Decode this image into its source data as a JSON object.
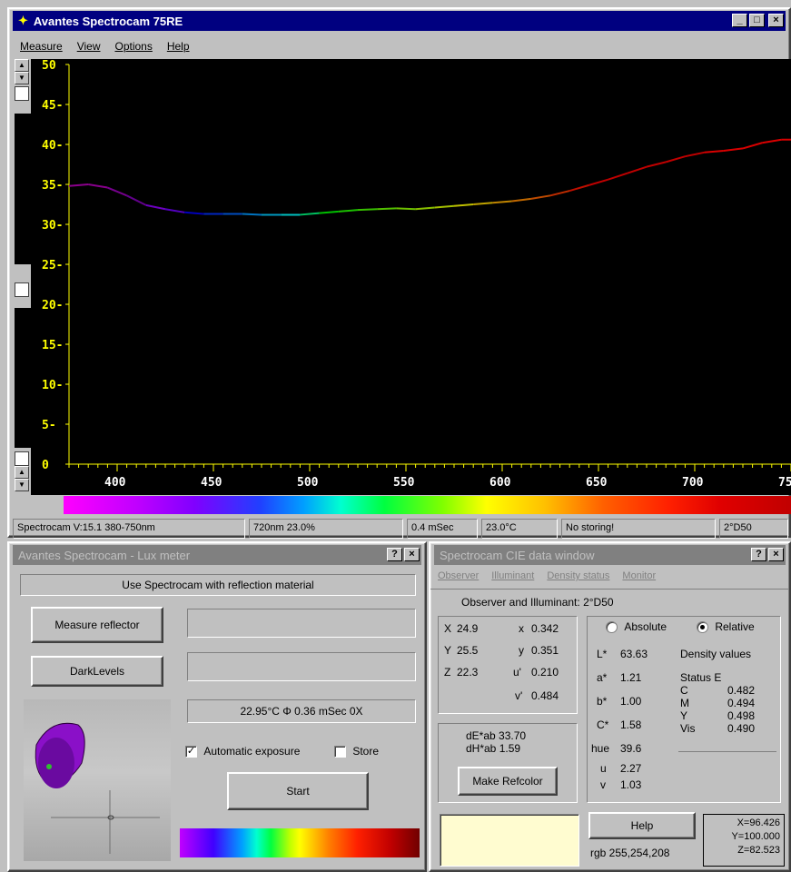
{
  "main": {
    "title": "Avantes Spectrocam 75RE",
    "menu": [
      "Measure",
      "View",
      "Options",
      "Help"
    ],
    "window_buttons": {
      "minimize": "_",
      "maximize": "□",
      "close": "×"
    },
    "status": [
      "Spectrocam V:15.1 380-750nm",
      "720nm 23.0%",
      "0.4 mSec",
      "23.0°C",
      "No storing!",
      "2°D50"
    ]
  },
  "chart_data": {
    "type": "line",
    "xlim": [
      375,
      750
    ],
    "ylim": [
      0,
      50
    ],
    "x_ticks": [
      400,
      450,
      500,
      550,
      600,
      650,
      700,
      750
    ],
    "x_tick_labels": [
      "400",
      "450",
      "500",
      "550",
      "600",
      "650",
      "700",
      "750"
    ],
    "y_ticks": [
      0,
      5,
      10,
      15,
      20,
      25,
      30,
      35,
      40,
      45,
      50
    ],
    "y_tick_labels": [
      "0",
      "5-",
      "10-",
      "15-",
      "20-",
      "25-",
      "30-",
      "35-",
      "40-",
      "45-",
      "50"
    ],
    "axis_color": "#ffff00",
    "background": "#000000",
    "series": [
      {
        "x": [
          375,
          385,
          395,
          405,
          415,
          425,
          435,
          445,
          455,
          465,
          475,
          485,
          495,
          505,
          515,
          525,
          535,
          545,
          555,
          565,
          575,
          585,
          595,
          605,
          615,
          625,
          635,
          645,
          655,
          665,
          675,
          685,
          695,
          705,
          715,
          725,
          735,
          745,
          750
        ],
        "y": [
          34.8,
          35.0,
          34.6,
          33.6,
          32.4,
          31.9,
          31.5,
          31.3,
          31.3,
          31.3,
          31.2,
          31.2,
          31.2,
          31.4,
          31.6,
          31.8,
          31.9,
          32.0,
          31.9,
          32.1,
          32.3,
          32.5,
          32.7,
          32.9,
          33.2,
          33.6,
          34.2,
          34.9,
          35.6,
          36.4,
          37.2,
          37.8,
          38.5,
          39.0,
          39.2,
          39.5,
          40.2,
          40.6,
          40.6
        ]
      }
    ]
  },
  "lux": {
    "title": "Avantes Spectrocam - Lux meter",
    "title_buttons": {
      "help": "?",
      "close": "×"
    },
    "hint": "Use Spectrocam with reflection material",
    "measure_reflector": "Measure reflector",
    "dark_levels": "DarkLevels",
    "field1": "",
    "field2": "",
    "readout": "22.95°C Φ 0.36 mSec 0X",
    "auto_exposure_label": "Automatic exposure",
    "auto_exposure_checked": "✓",
    "store_label": "Store",
    "start": "Start"
  },
  "cie": {
    "title": "Spectrocam CIE data window",
    "title_buttons": {
      "help": "?",
      "close": "×"
    },
    "menu": [
      "Observer",
      "Illuminant",
      "Density status",
      "Monitor"
    ],
    "observer_line": "Observer and Illuminant: 2°D50",
    "xyz": [
      {
        "label": "X",
        "value": "24.9",
        "l2": "x",
        "v2": "0.342"
      },
      {
        "label": "Y",
        "value": "25.5",
        "l2": "y",
        "v2": "0.351"
      },
      {
        "label": "Z",
        "value": "22.3",
        "l2": "u'",
        "v2": "0.210"
      },
      {
        "label": "",
        "value": "",
        "l2": "v'",
        "v2": "0.484"
      }
    ],
    "de_ab": "dE*ab 33.70",
    "dh_ab": "dH*ab 1.59",
    "make_ref": "Make Refcolor",
    "absolute": "Absolute",
    "relative": "Relative",
    "lab": [
      {
        "label": "L*",
        "value": "63.63"
      },
      {
        "label": "a*",
        "value": "1.21"
      },
      {
        "label": "b*",
        "value": "1.00"
      },
      {
        "label": "C*",
        "value": "1.58"
      },
      {
        "label": "hue",
        "value": "39.6"
      },
      {
        "label": "u",
        "value": "2.27"
      },
      {
        "label": "v",
        "value": "1.03"
      }
    ],
    "density_title": "Density values",
    "status_e": "Status E",
    "density": [
      {
        "label": "C",
        "value": "0.482"
      },
      {
        "label": "M",
        "value": "0.494"
      },
      {
        "label": "Y",
        "value": "0.498"
      },
      {
        "label": "Vis",
        "value": "0.490"
      }
    ],
    "swatch_color": "#fffcd0",
    "help": "Help",
    "rgb": "rgb 255,254,208",
    "xyz_box": [
      "X=96.426",
      "Y=100.000",
      "Z=82.523"
    ]
  }
}
